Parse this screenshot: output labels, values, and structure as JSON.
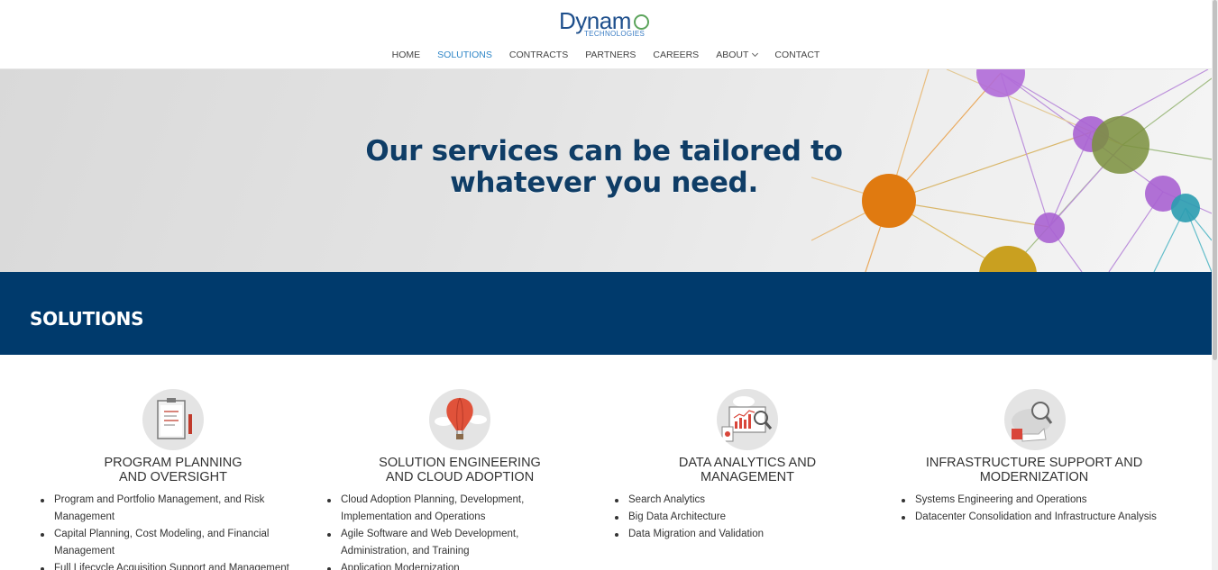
{
  "logo": {
    "name": "Dynam",
    "sub": "TECHNOLOGIES"
  },
  "nav": {
    "home": "HOME",
    "solutions": "SOLUTIONS",
    "contracts": "CONTRACTS",
    "partners": "PARTNERS",
    "careers": "CAREERS",
    "about": "ABOUT",
    "contact": "CONTACT"
  },
  "hero": {
    "line1": "Our services can be tailored to",
    "line2": "whatever you need."
  },
  "band": {
    "title": "SOLUTIONS"
  },
  "columns": [
    {
      "title1": "PROGRAM PLANNING",
      "title2": "AND OVERSIGHT",
      "items": [
        {
          "l1": "Program and Portfolio Management, and Risk",
          "l2": "Management"
        },
        {
          "l1": "Capital Planning, Cost Modeling, and Financial",
          "l2": "Management"
        },
        {
          "l1": "Full Lifecycle Acquisition Support and Management",
          "l2": ""
        }
      ]
    },
    {
      "title1": "SOLUTION ENGINEERING",
      "title2": "AND CLOUD ADOPTION",
      "items": [
        {
          "l1": "Cloud Adoption Planning, Development,",
          "l2": "Implementation and Operations"
        },
        {
          "l1": "Agile Software and Web Development,",
          "l2": "Administration, and Training"
        },
        {
          "l1": "Application Modernization",
          "l2": ""
        }
      ]
    },
    {
      "title1": "DATA ANALYTICS AND",
      "title2": "MANAGEMENT",
      "items": [
        {
          "l1": "Search Analytics",
          "l2": ""
        },
        {
          "l1": "Big Data Architecture",
          "l2": ""
        },
        {
          "l1": "Data Migration and Validation",
          "l2": ""
        }
      ]
    },
    {
      "title1": "INFRASTRUCTURE SUPPORT AND",
      "title2": "MODERNIZATION",
      "items": [
        {
          "l1": "Systems Engineering and Operations",
          "l2": ""
        },
        {
          "l1": "Datacenter Consolidation and Infrastructure Analysis",
          "l2": ""
        }
      ]
    }
  ],
  "colors": {
    "brand": "#003a6c",
    "heroText": "#0f3d66",
    "navActive": "#2e86c7"
  }
}
